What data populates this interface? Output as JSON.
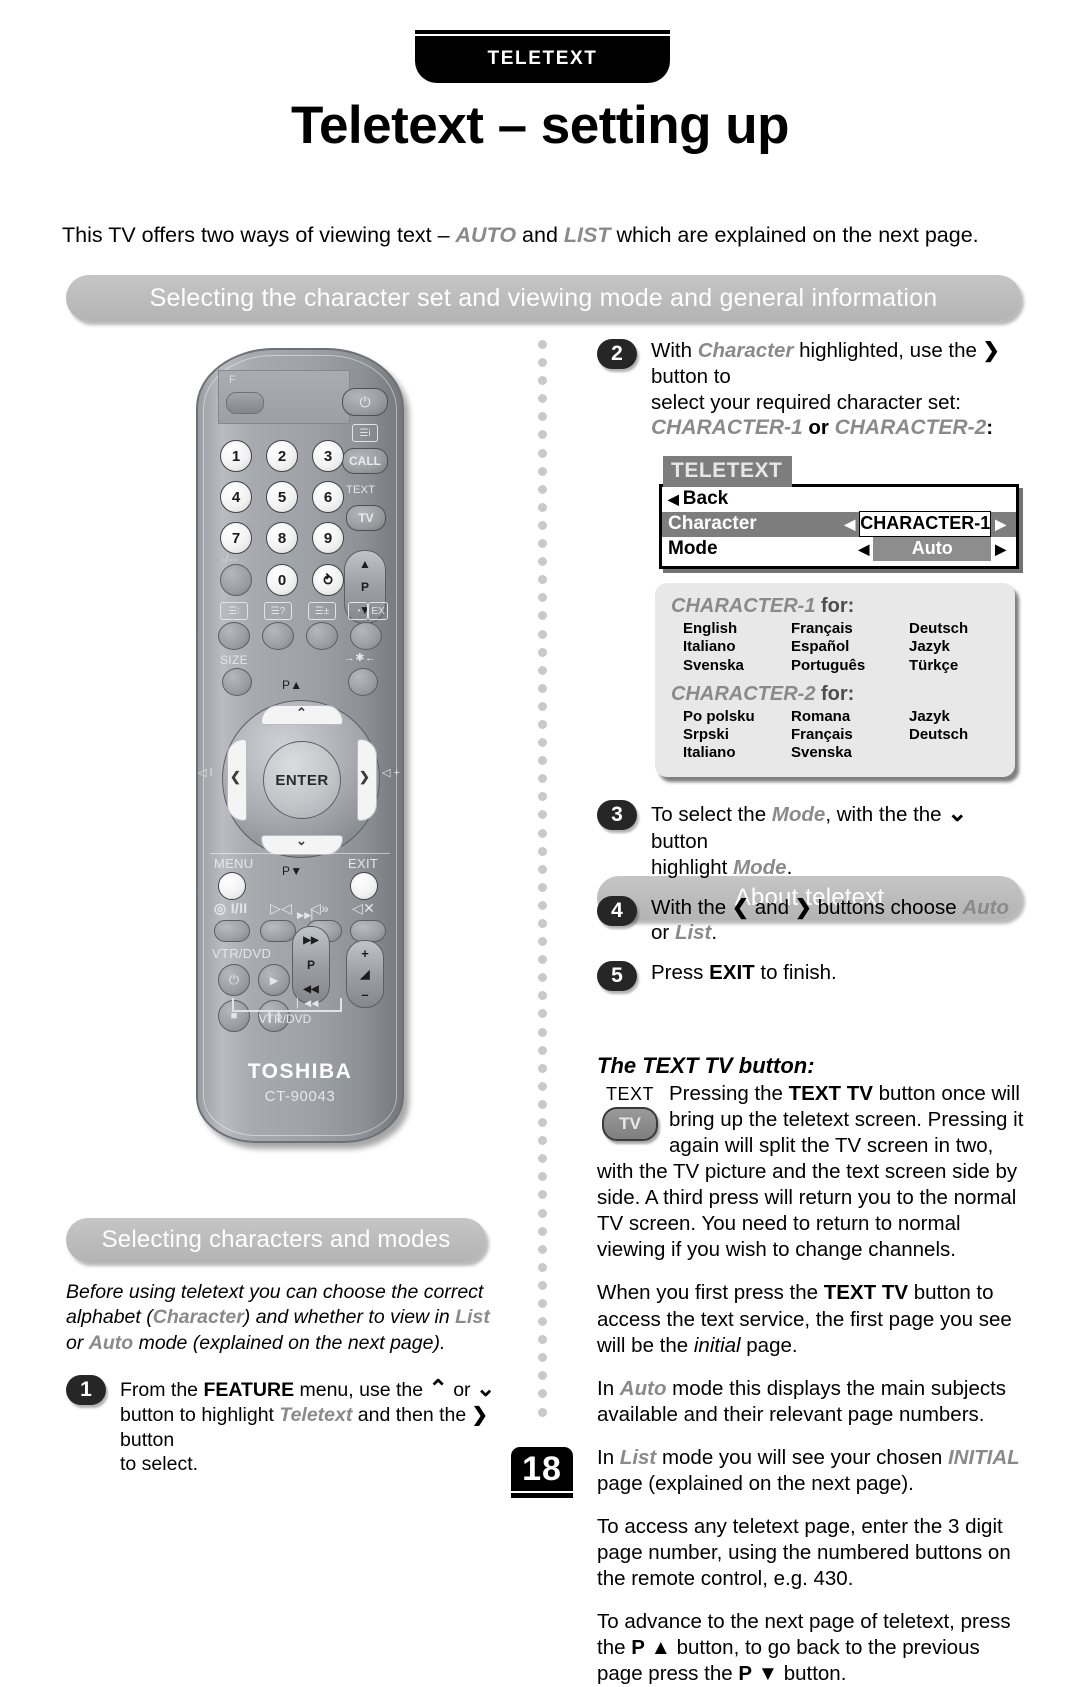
{
  "header": {
    "tab_label": "TELETEXT",
    "page_title": "Teletext – setting up"
  },
  "intro": {
    "t1": "This TV offers two ways of viewing text – ",
    "auto": "AUTO",
    "t2": " and ",
    "list": "LIST",
    "t3": " which are explained on the next page."
  },
  "banners": {
    "main": "Selecting the character set and viewing mode and general information",
    "chars": "Selecting characters and modes",
    "about": "About teletext"
  },
  "steps": {
    "s2": {
      "num": "2",
      "l1a": "With ",
      "l1b": "Character",
      "l1c": " highlighted, use the ",
      "l1arrow": "❯",
      "l1d": " button to",
      "l2": "select your required character set:",
      "l3a": "CHARACTER-1",
      "l3b": " or ",
      "l3c": "CHARACTER-2",
      "l3d": ":"
    },
    "s3": {
      "num": "3",
      "l1a": "To select the ",
      "l1b": "Mode",
      "l1c": ", with the the ",
      "l1arrow": "⌄",
      "l1d": " button",
      "l2a": "highlight ",
      "l2b": "Mode",
      "l2c": "."
    },
    "s4": {
      "num": "4",
      "a": "With the ",
      "left": "❮",
      "b": " and ",
      "right": "❯",
      "c": " buttons choose ",
      "auto": "Auto",
      "d": " or ",
      "list": "List",
      "e": "."
    },
    "s5": {
      "num": "5",
      "a": "Press ",
      "exit": "EXIT",
      "b": " to finish."
    },
    "s1": {
      "num": "1",
      "a": "From the ",
      "feature": "FEATURE",
      "b": " menu, use the ",
      "up": "⌃",
      "c": " or ",
      "down": "⌄",
      "d": "button to highlight ",
      "teletext": "Teletext",
      "e": " and then the ",
      "right": "❯",
      "f": " button",
      "g": "to select."
    }
  },
  "osd": {
    "title": "TELETEXT",
    "rows": [
      {
        "left_arrow": "◀",
        "label": "Back",
        "value": null,
        "selected": false
      },
      {
        "label": "Character",
        "left_arrow": "◀",
        "value": "CHARACTER-1",
        "right_arrow": "▶",
        "selected": true,
        "value_style": "white"
      },
      {
        "label": "Mode",
        "left_arrow": "◀",
        "value": "Auto",
        "right_arrow": "▶",
        "selected": false,
        "value_style": "grey"
      }
    ]
  },
  "charbox": {
    "group1_title": "CHARACTER-1",
    "group1_for": " for:",
    "group1": [
      "English",
      "Français",
      "Deutsch",
      "Italiano",
      "Español",
      "Jazyk",
      "Svenska",
      "Português",
      "Türkçe"
    ],
    "group2_title": "CHARACTER-2",
    "group2_for": " for:",
    "group2": [
      "Po polsku",
      "Romana",
      "Jazyk",
      "Srpski",
      "Français",
      "Deutsch",
      "Italiano",
      "Svenska",
      ""
    ]
  },
  "about": {
    "heading": "The TEXT TV button:",
    "icon_label": "TEXT",
    "icon_button": "TV",
    "p1a": "Pressing the ",
    "p1b": "TEXT TV",
    "p1c": " button once will bring up the teletext screen. Pressing it again will split the TV screen in two, with the TV picture and the text screen side by side. A third press will return you to the normal TV screen. You need to return to normal viewing if you wish to change channels.",
    "p2a": "When you first press the ",
    "p2b": "TEXT TV",
    "p2c": " button to access the text service, the first page you see will be the ",
    "p2d": "initial",
    "p2e": " page.",
    "p3a": "In ",
    "p3b": "Auto",
    "p3c": " mode this displays the main subjects available and their relevant page numbers.",
    "p4a": "In ",
    "p4b": "List",
    "p4c": " mode you will see your chosen ",
    "p4d": "INITIAL",
    "p4e": " page (explained on the next page).",
    "p5": "To access any teletext page, enter the 3 digit page number, using the numbered buttons on the remote control, e.g. 430.",
    "p6a": "To advance to the next page of teletext, press the ",
    "p6b": "P",
    "p6up": "▲",
    "p6c": " button, to go back to the previous page press the ",
    "p6d": "P",
    "p6down": "▼",
    "p6e": " button."
  },
  "chars_section": {
    "pre_a": "Before using teletext you can choose the correct alphabet (",
    "pre_b": "Character",
    "pre_c": ") and whether to view in ",
    "pre_d": "List",
    "pre_e": " or ",
    "pre_f": "Auto",
    "pre_g": " mode (explained on the next page)."
  },
  "remote": {
    "brand": "TOSHIBA",
    "model": "CT-90043",
    "f_label": "F",
    "power": "⏻",
    "call": "CALL",
    "call_icon": "☰i",
    "text_label": "TEXT",
    "tv_label": "TV",
    "p_label": "P",
    "p_up": "▲",
    "p_down": "▼",
    "size_label": "SIZE",
    "menu_label": "MENU",
    "exit_label": "EXIT",
    "enter_label": "ENTER",
    "p_up_label": "P▲",
    "p_down_label": "P▼",
    "vtr_label": "VTR/DVD",
    "vtr_label2": "VTR/DVD",
    "vol_plus": "+",
    "vol_minus": "–",
    "vol_icon": "◢",
    "keys": [
      "1",
      "2",
      "3",
      "4",
      "5",
      "6",
      "7",
      "8",
      "9",
      "0"
    ],
    "dash_key": "-/--",
    "input_key": "⥁",
    "audio_key": "◎ I/II",
    "stereo_key": "▷◁",
    "sound_key": "◁»",
    "mute_key": "◁✕",
    "teletext_icons": [
      "☰∶",
      "☰?",
      "☰±",
      "◔",
      "EX"
    ],
    "freeze_icon": "→✱←",
    "nav_up": "⌃",
    "nav_down": "⌄",
    "nav_left": "❮",
    "nav_right": "❯",
    "vol_down_icon": "◁ I",
    "vol_up_icon": "◁ +",
    "power_vtr": "⏻",
    "play": "▶",
    "stop": "■",
    "pause": "❙❙",
    "ffwd": "▶▶",
    "frew": "◀◀",
    "next": "▶▶▏",
    "prev": "▏◀◀"
  },
  "page_number": "18"
}
